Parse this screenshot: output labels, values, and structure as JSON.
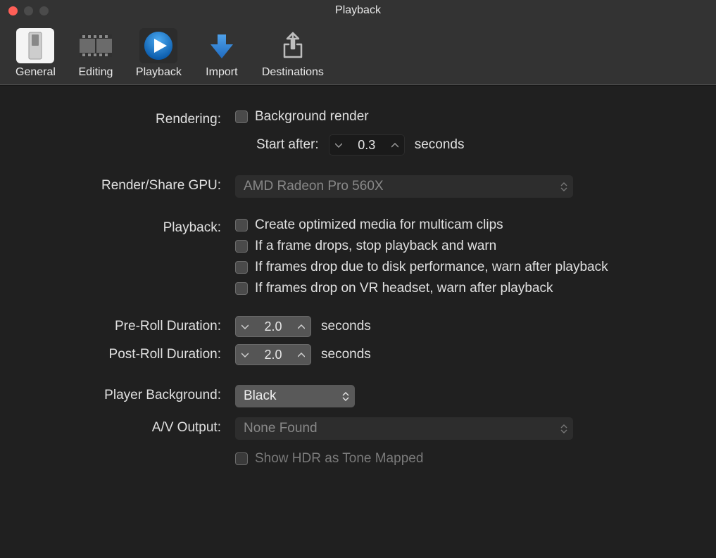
{
  "window": {
    "title": "Playback"
  },
  "toolbar": {
    "items": [
      {
        "label": "General"
      },
      {
        "label": "Editing"
      },
      {
        "label": "Playback"
      },
      {
        "label": "Import"
      },
      {
        "label": "Destinations"
      }
    ]
  },
  "form": {
    "rendering": {
      "label": "Rendering:",
      "bg_render": "Background render",
      "start_after_label": "Start after:",
      "start_after_value": "0.3",
      "start_after_unit": "seconds"
    },
    "gpu": {
      "label": "Render/Share GPU:",
      "value": "AMD Radeon Pro 560X"
    },
    "playback": {
      "label": "Playback:",
      "opts": [
        "Create optimized media for multicam clips",
        "If a frame drops, stop playback and warn",
        "If frames drop due to disk performance, warn after playback",
        "If frames drop on VR headset, warn after playback"
      ]
    },
    "preroll": {
      "label": "Pre-Roll Duration:",
      "value": "2.0",
      "unit": "seconds"
    },
    "postroll": {
      "label": "Post-Roll Duration:",
      "value": "2.0",
      "unit": "seconds"
    },
    "player_bg": {
      "label": "Player Background:",
      "value": "Black"
    },
    "av_output": {
      "label": "A/V Output:",
      "value": "None Found"
    },
    "hdr": {
      "label": "Show HDR as Tone Mapped"
    }
  }
}
